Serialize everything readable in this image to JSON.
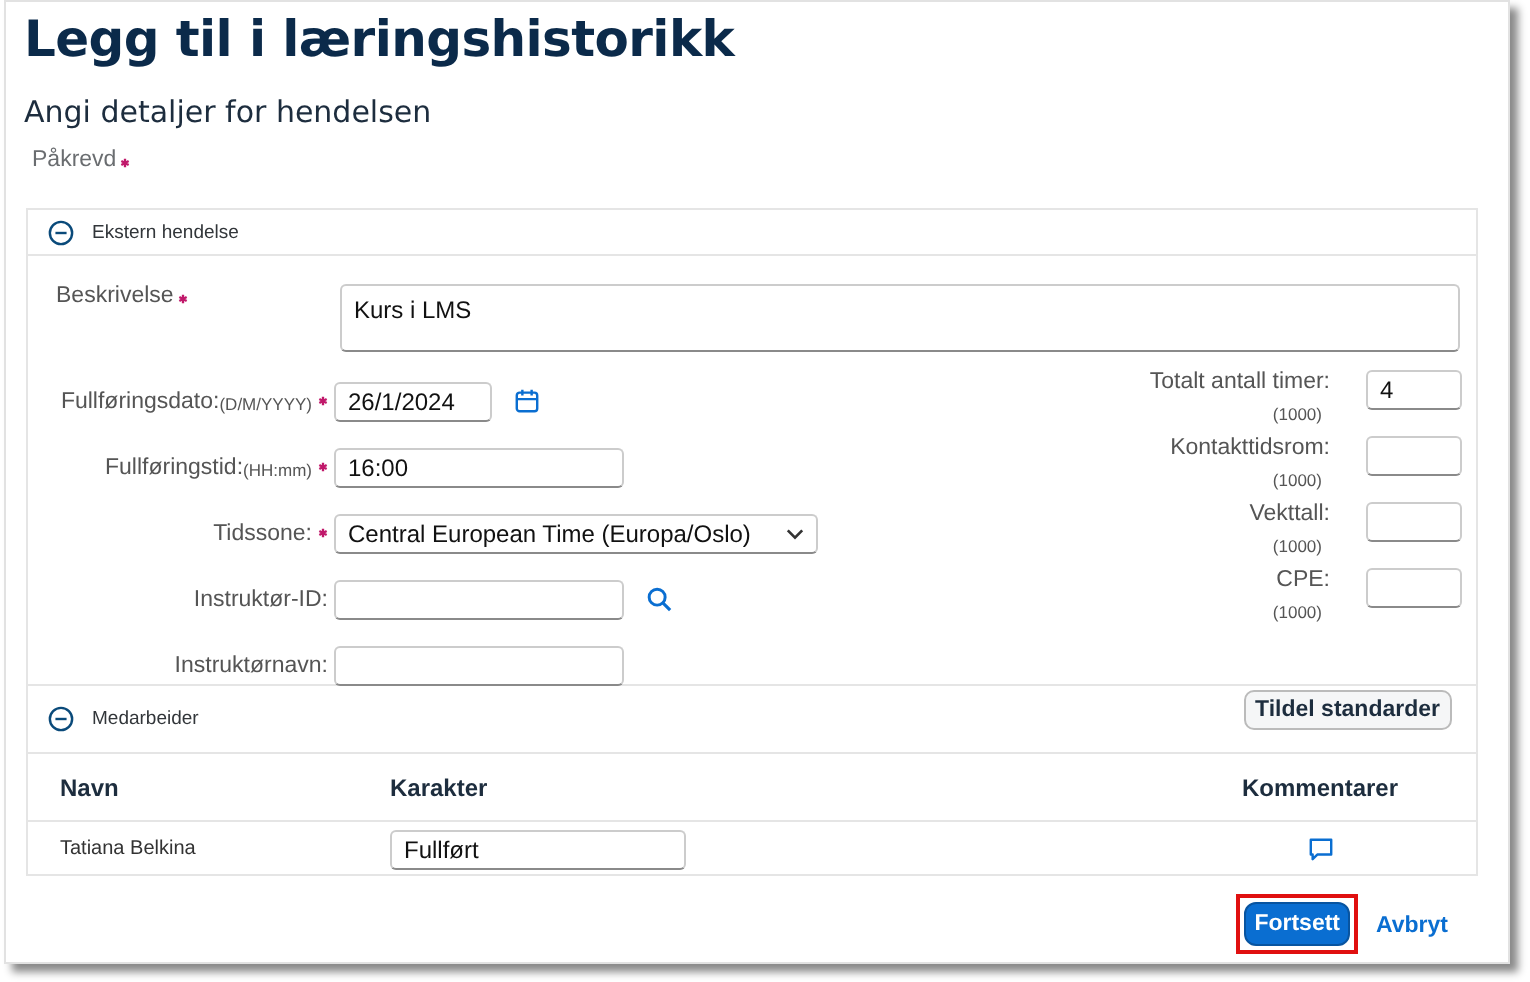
{
  "title": "Legg til i læringshistorikk",
  "subtitle": "Angi detaljer for hendelsen",
  "required_note": "Påkrevd",
  "event_section": {
    "title": "Ekstern hendelse",
    "expanded": true,
    "description": {
      "label": "Beskrivelse",
      "required": true,
      "value": "Kurs i LMS"
    },
    "left_fields": [
      {
        "kind": "date",
        "label": "Fullføringsdato:",
        "hint": "(D/M/YYYY)",
        "required": true,
        "value": "26/1/2024"
      },
      {
        "kind": "text",
        "label": "Fullføringstid:",
        "hint": "(HH:mm)",
        "required": true,
        "value": "16:00"
      },
      {
        "kind": "select",
        "label": "Tidssone:",
        "required": true,
        "value": "Central European Time (Europa/Oslo)"
      },
      {
        "kind": "search",
        "label": "Instruktør-ID:",
        "required": false
      },
      {
        "kind": "text",
        "label": "Instruktørnavn:",
        "required": false
      }
    ],
    "right_fields": [
      {
        "label": "Totalt antall timer:",
        "hint": "(1000)",
        "value": "4"
      },
      {
        "label": "Kontakttidsrom:",
        "hint": "(1000)"
      },
      {
        "label": "Vekttall:",
        "hint": "(1000)"
      },
      {
        "label": "CPE:",
        "hint": "(1000)"
      }
    ]
  },
  "employee_section": {
    "title": "Medarbeider",
    "expanded": true,
    "action": "Tildel standarder",
    "columns": [
      "Navn",
      "Karakter",
      "Kommentarer"
    ],
    "rows": [
      {
        "name": "Tatiana Belkina",
        "grade": "Fullført"
      }
    ]
  },
  "buttons": [
    {
      "kind": "primary",
      "label": "Fortsett",
      "highlighted": true
    },
    {
      "kind": "link",
      "label": "Avbryt",
      "highlighted": false
    }
  ]
}
